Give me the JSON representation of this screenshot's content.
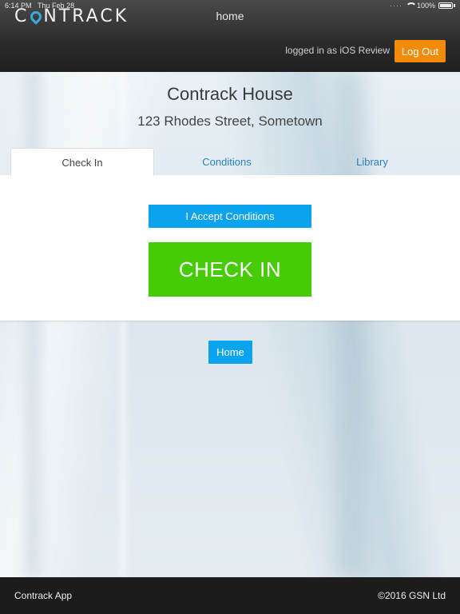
{
  "statusbar": {
    "time": "6:14 PM",
    "date": "Thu Feb 28",
    "battery": "100%"
  },
  "header": {
    "logo_text_left": "C",
    "logo_text_right": "NTRACK",
    "title": "home",
    "logged_in_text": "logged in as iOS Review",
    "logout_label": "Log Out"
  },
  "property": {
    "name": "Contrack House",
    "address": "123 Rhodes Street, Sometown"
  },
  "tabs": [
    {
      "label": "Check In",
      "active": true
    },
    {
      "label": "Conditions",
      "active": false
    },
    {
      "label": "Library",
      "active": false
    }
  ],
  "actions": {
    "accept_label": "I Accept Conditions",
    "checkin_label": "CHECK IN",
    "home_label": "Home"
  },
  "footer": {
    "app_name": "Contrack App",
    "copyright": "©2016 GSN Ltd"
  },
  "colors": {
    "accent_orange": "#f28a0a",
    "accent_blue": "#0aa4ee",
    "accent_green": "#45cc05"
  }
}
